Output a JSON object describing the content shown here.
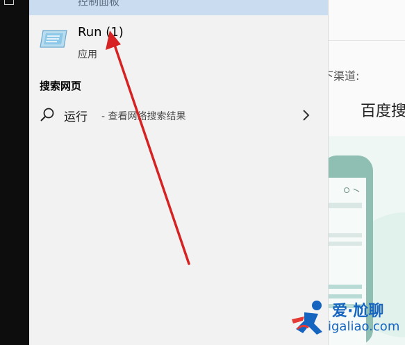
{
  "selected_item": {
    "label": "控制面板"
  },
  "best_match": {
    "title": "Run (1)",
    "subtitle": "应用",
    "icon": "run-app-icon"
  },
  "web_section": {
    "heading": "搜索网页"
  },
  "web_result": {
    "query": "运行",
    "hint": "- 查看网络搜索结果",
    "icon": "search-icon",
    "chevron": "chevron-right-icon"
  },
  "preview": {
    "channel_label": "下渠道:",
    "title": "百度搜"
  },
  "watermark": {
    "name": "爱·尬聊",
    "url": "igaliao.com"
  },
  "colors": {
    "selected_strip": "#c9dcf0",
    "panel": "#f2f2f2",
    "arrow": "#d62222",
    "watermark": "#1565c0"
  }
}
